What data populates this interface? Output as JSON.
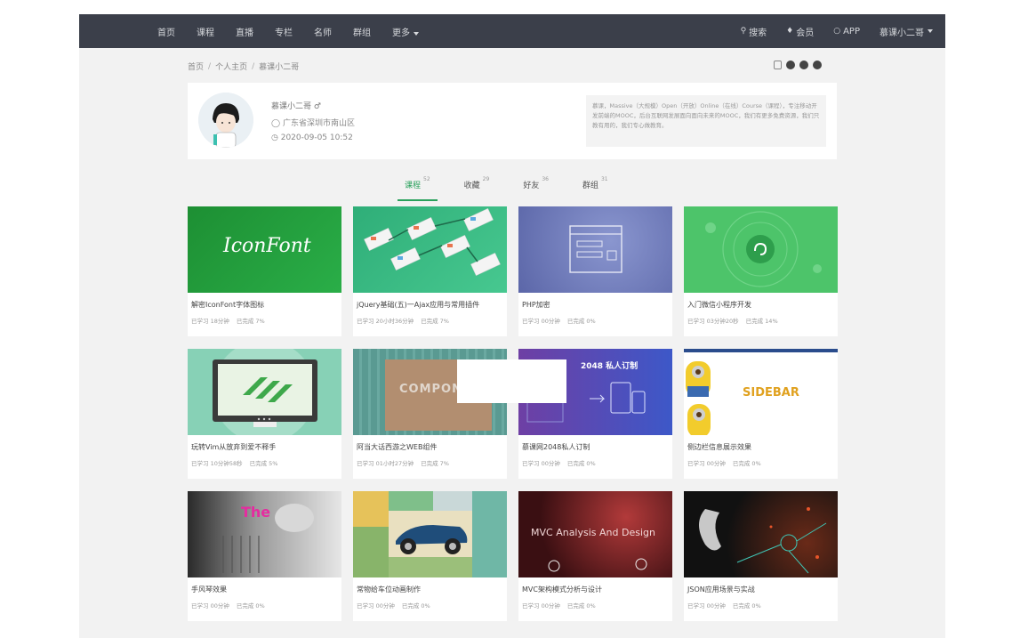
{
  "nav": {
    "left": [
      "首页",
      "课程",
      "直播",
      "专栏",
      "名师",
      "群组",
      "更多"
    ],
    "right": {
      "search": "搜索",
      "member": "会员",
      "app": "APP",
      "user": "慕课小二哥"
    }
  },
  "breadcrumb": [
    "首页",
    "个人主页",
    "慕课小二哥"
  ],
  "profile": {
    "name": "慕课小二哥 ♂",
    "location": "广东省深圳市南山区",
    "date": "2020-09-05 10:52",
    "bio": "慕课，Massive（大规模）Open（开放）Online（在线）Course（课程），专注移动开发前端的MOOC，后台互联网发展面向面向未来的MOOC，我们有更多免费资源，我们只教有用的，我们专心做教育。"
  },
  "tabs": [
    {
      "label": "课程",
      "count": "52",
      "active": true
    },
    {
      "label": "收藏",
      "count": "29"
    },
    {
      "label": "好友",
      "count": "36"
    },
    {
      "label": "群组",
      "count": "31"
    }
  ],
  "courses": [
    {
      "title": "解密IconFont字体图标",
      "learned": "已学习 18分钟",
      "done": "已完成 7%",
      "thumb_text": "IconFont",
      "bg": "#1f9a3c"
    },
    {
      "title": "jQuery基础(五)一Ajax应用与常用插件",
      "learned": "已学习 20小时36分钟",
      "done": "已完成 7%",
      "bg": "#3bbf86"
    },
    {
      "title": "PHP加密",
      "learned": "已学习 00分钟",
      "done": "已完成 0%",
      "bg": "#6d79b8"
    },
    {
      "title": "入门微信小程序开发",
      "learned": "已学习 03分钟20秒",
      "done": "已完成 14%",
      "bg": "#4fc46a"
    },
    {
      "title": "玩转Vim从放弃到爱不释手",
      "learned": "已学习 10分钟58秒",
      "done": "已完成 5%",
      "bg": "#8ad3b8"
    },
    {
      "title": "阿当大话西游之WEB组件",
      "learned": "已学习 01小时27分钟",
      "done": "已完成 7%",
      "thumb_text": "COMPONE",
      "bg": "#5e9e96"
    },
    {
      "title": "慕课网2048私人订制",
      "learned": "已学习 00分钟",
      "done": "已完成 0%",
      "thumb_text": "2048 私人订制",
      "bg": "#4f57b8"
    },
    {
      "title": "侧边栏信息展示效果",
      "learned": "已学习 00分钟",
      "done": "已完成 0%",
      "thumb_text": "SIDEBAR",
      "bg": "#ffffff"
    },
    {
      "title": "手风琴效果",
      "learned": "已学习 00分钟",
      "done": "已完成 0%",
      "thumb_text": "The",
      "bg": "#7a7a7a"
    },
    {
      "title": "常物给车位动画制作",
      "learned": "已学习 00分钟",
      "done": "已完成 0%",
      "bg": "#c9b25a"
    },
    {
      "title": "MVC架构模式分析与设计",
      "learned": "已学习 00分钟",
      "done": "已完成 0%",
      "thumb_text": "MVC Analysis And Design",
      "bg": "#6a1f20"
    },
    {
      "title": "JSON应用场景与实战",
      "learned": "已学习 00分钟",
      "done": "已完成 0%",
      "bg": "#1a1a1a"
    }
  ]
}
